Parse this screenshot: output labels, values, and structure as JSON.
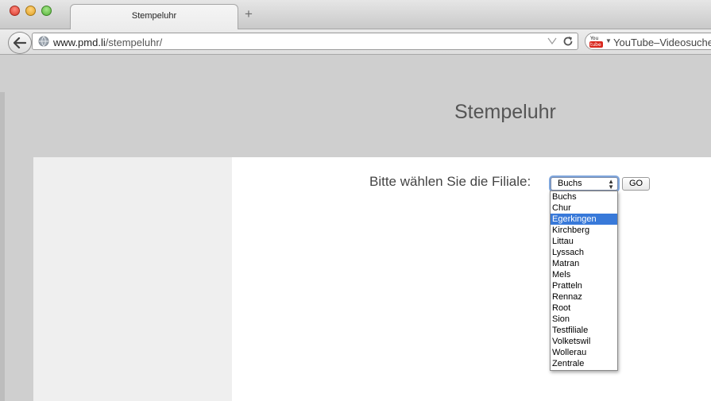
{
  "browser": {
    "tab_title": "Stempeluhr",
    "new_tab_label": "+",
    "url_host": "www.pmd.li",
    "url_path": "/stempeluhr/",
    "search_placeholder": "YouTube–Videosuche",
    "search_engine_icon": "youtube-icon"
  },
  "page": {
    "title": "Stempeluhr",
    "prompt": "Bitte wählen Sie die Filiale:",
    "select_value": "Buchs",
    "go_label": "GO",
    "options": [
      "Buchs",
      "Chur",
      "Egerkingen",
      "Kirchberg",
      "Littau",
      "Lyssach",
      "Matran",
      "Mels",
      "Pratteln",
      "Rennaz",
      "Root",
      "Sion",
      "Testfiliale",
      "Volketswil",
      "Wollerau",
      "Zentrale"
    ],
    "highlighted_option": "Egerkingen"
  },
  "colors": {
    "highlight": "#3879d9",
    "page_bg": "#cfcfcf",
    "sidebar_bg": "#efefef"
  }
}
